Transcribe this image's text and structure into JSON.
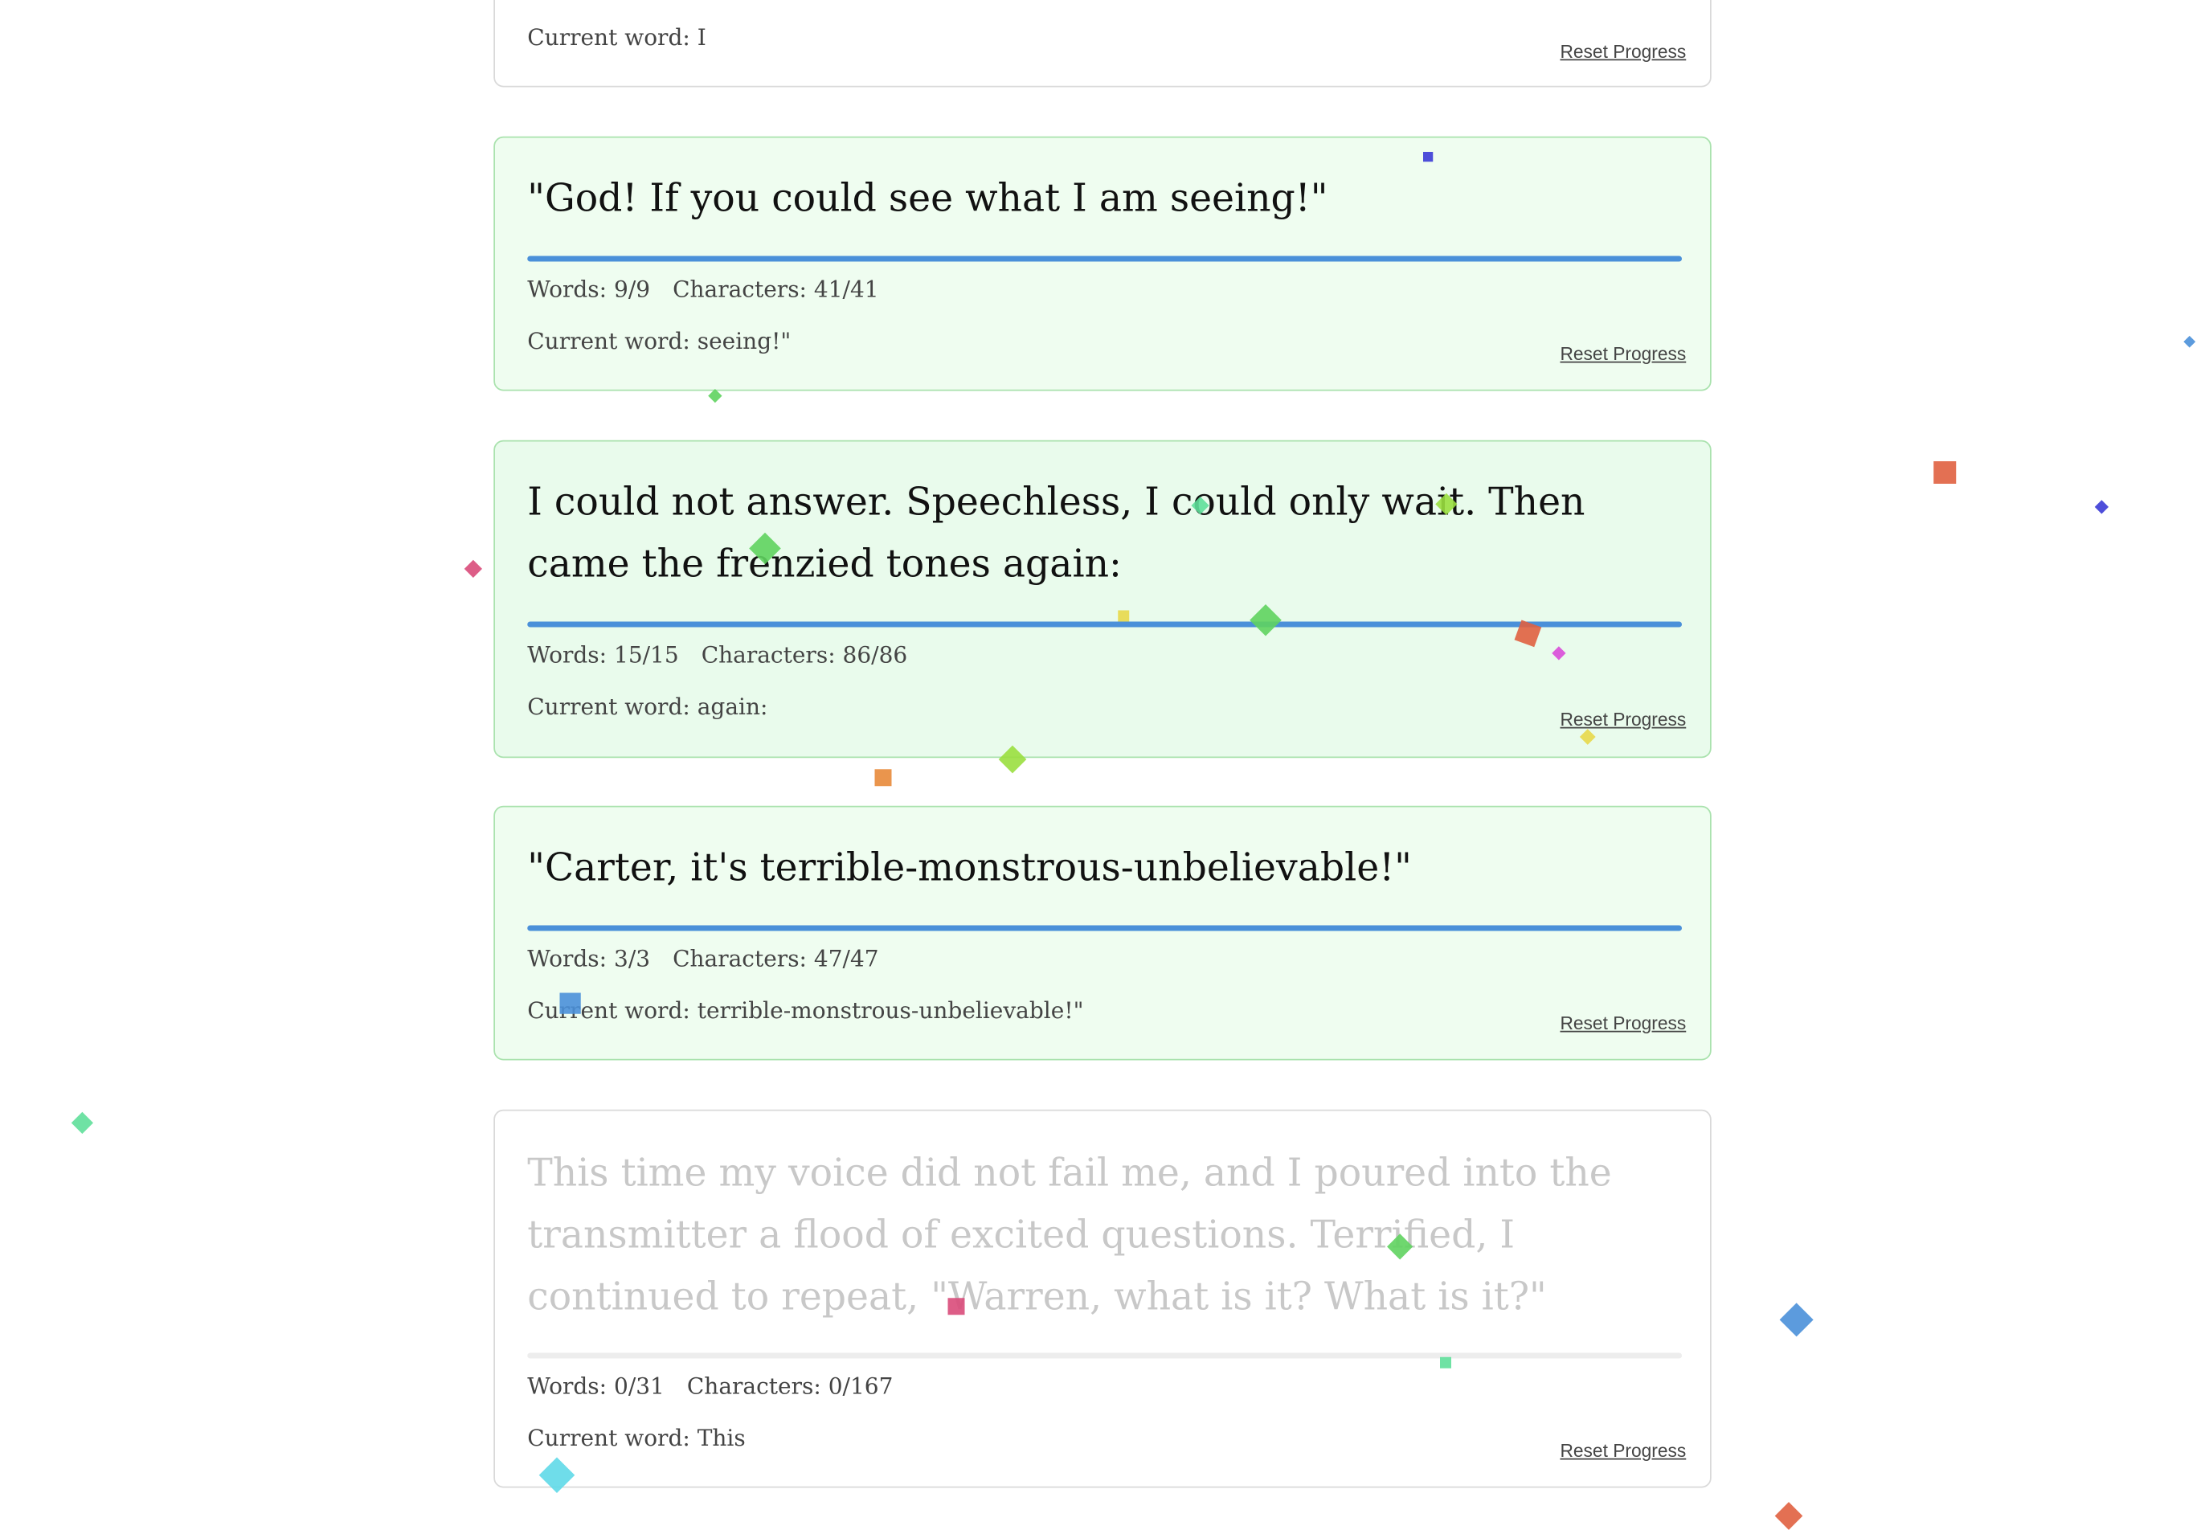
{
  "cards": [
    {
      "state": "complete",
      "passage": "",
      "current_word_label": "Current word: I",
      "reset_label": "Reset Progress"
    },
    {
      "state": "complete",
      "passage": "\"God! If you could see what I am seeing!\"",
      "progress": 1.0,
      "words_label": "Words: 9/9",
      "chars_label": "Characters: 41/41",
      "current_word_label": "Current word: seeing!\"",
      "reset_label": "Reset Progress"
    },
    {
      "state": "complete",
      "passage": "I could not answer. Speechless, I could only wait. Then came the frenzied tones again:",
      "progress": 1.0,
      "words_label": "Words: 15/15",
      "chars_label": "Characters: 86/86",
      "current_word_label": "Current word: again:",
      "reset_label": "Reset Progress"
    },
    {
      "state": "complete",
      "passage": "\"Carter, it's terrible-monstrous-unbelievable!\"",
      "progress": 1.0,
      "words_label": "Words: 3/3",
      "chars_label": "Characters: 47/47",
      "current_word_label": "Current word: terrible-monstrous-unbelievable!\"",
      "reset_label": "Reset Progress"
    },
    {
      "state": "pending",
      "passage": "This time my voice did not fail me, and I poured into the transmitter a flood of excited questions. Terrified, I continued to repeat, \"Warren, what is it? What is it?\"",
      "progress": 0.0,
      "words_label": "Words: 0/31",
      "chars_label": "Characters: 0/167",
      "current_word_label": "Current word: This",
      "reset_label": "Reset Progress"
    }
  ],
  "colors": {
    "progress_fill": "#4a90d9",
    "complete_bg": "#effdf0",
    "complete_border": "#a9e2ad",
    "pending_text": "#c8c8c8"
  },
  "confetti_colors": [
    "#3b3bd6",
    "#5fd35f",
    "#e06040",
    "#d94b7a",
    "#e8d84a",
    "#e88a3a",
    "#9adf3f",
    "#4a90d9",
    "#5fd9e8",
    "#5fdf9a",
    "#d94bd9"
  ]
}
